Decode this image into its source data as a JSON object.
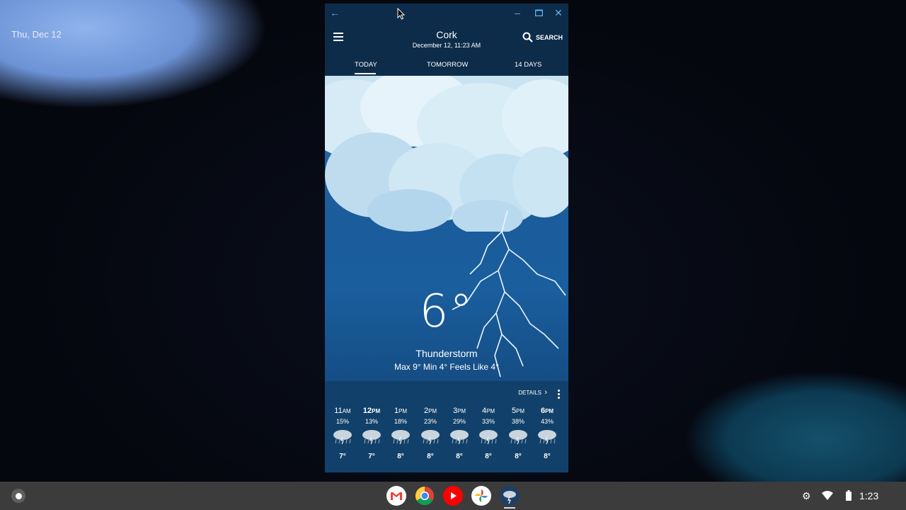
{
  "desktop": {
    "date": "Thu, Dec 12"
  },
  "window": {
    "city": "Cork",
    "datetime": "December 12, 11:23 AM",
    "search_label": "SEARCH",
    "tabs": [
      "TODAY",
      "TOMORROW",
      "14 DAYS"
    ],
    "active_tab": "TODAY"
  },
  "current": {
    "temperature": "6°",
    "condition": "Thunderstorm",
    "minmax": "Max 9° Min 4°   Feels Like 4°"
  },
  "hourly": {
    "details_label": "DETAILS",
    "hours": [
      {
        "time": "11",
        "ampm": "AM",
        "precip": "15%",
        "temp": "7°"
      },
      {
        "time": "12",
        "ampm": "PM",
        "precip": "13%",
        "temp": "7°"
      },
      {
        "time": "1",
        "ampm": "PM",
        "precip": "18%",
        "temp": "8°"
      },
      {
        "time": "2",
        "ampm": "PM",
        "precip": "23%",
        "temp": "8°"
      },
      {
        "time": "3",
        "ampm": "PM",
        "precip": "29%",
        "temp": "8°"
      },
      {
        "time": "4",
        "ampm": "PM",
        "precip": "33%",
        "temp": "8°"
      },
      {
        "time": "5",
        "ampm": "PM",
        "precip": "38%",
        "temp": "8°"
      },
      {
        "time": "6",
        "ampm": "PM",
        "precip": "43%",
        "temp": "8°"
      }
    ]
  },
  "shelf": {
    "apps": [
      "gmail-icon",
      "chrome-icon",
      "youtube-icon",
      "photos-icon",
      "weather-app-icon"
    ],
    "time": "1:23"
  },
  "colors": {
    "accent": "#5db1f0",
    "header": "#0d2c49",
    "scene": "#1b5c9b"
  }
}
